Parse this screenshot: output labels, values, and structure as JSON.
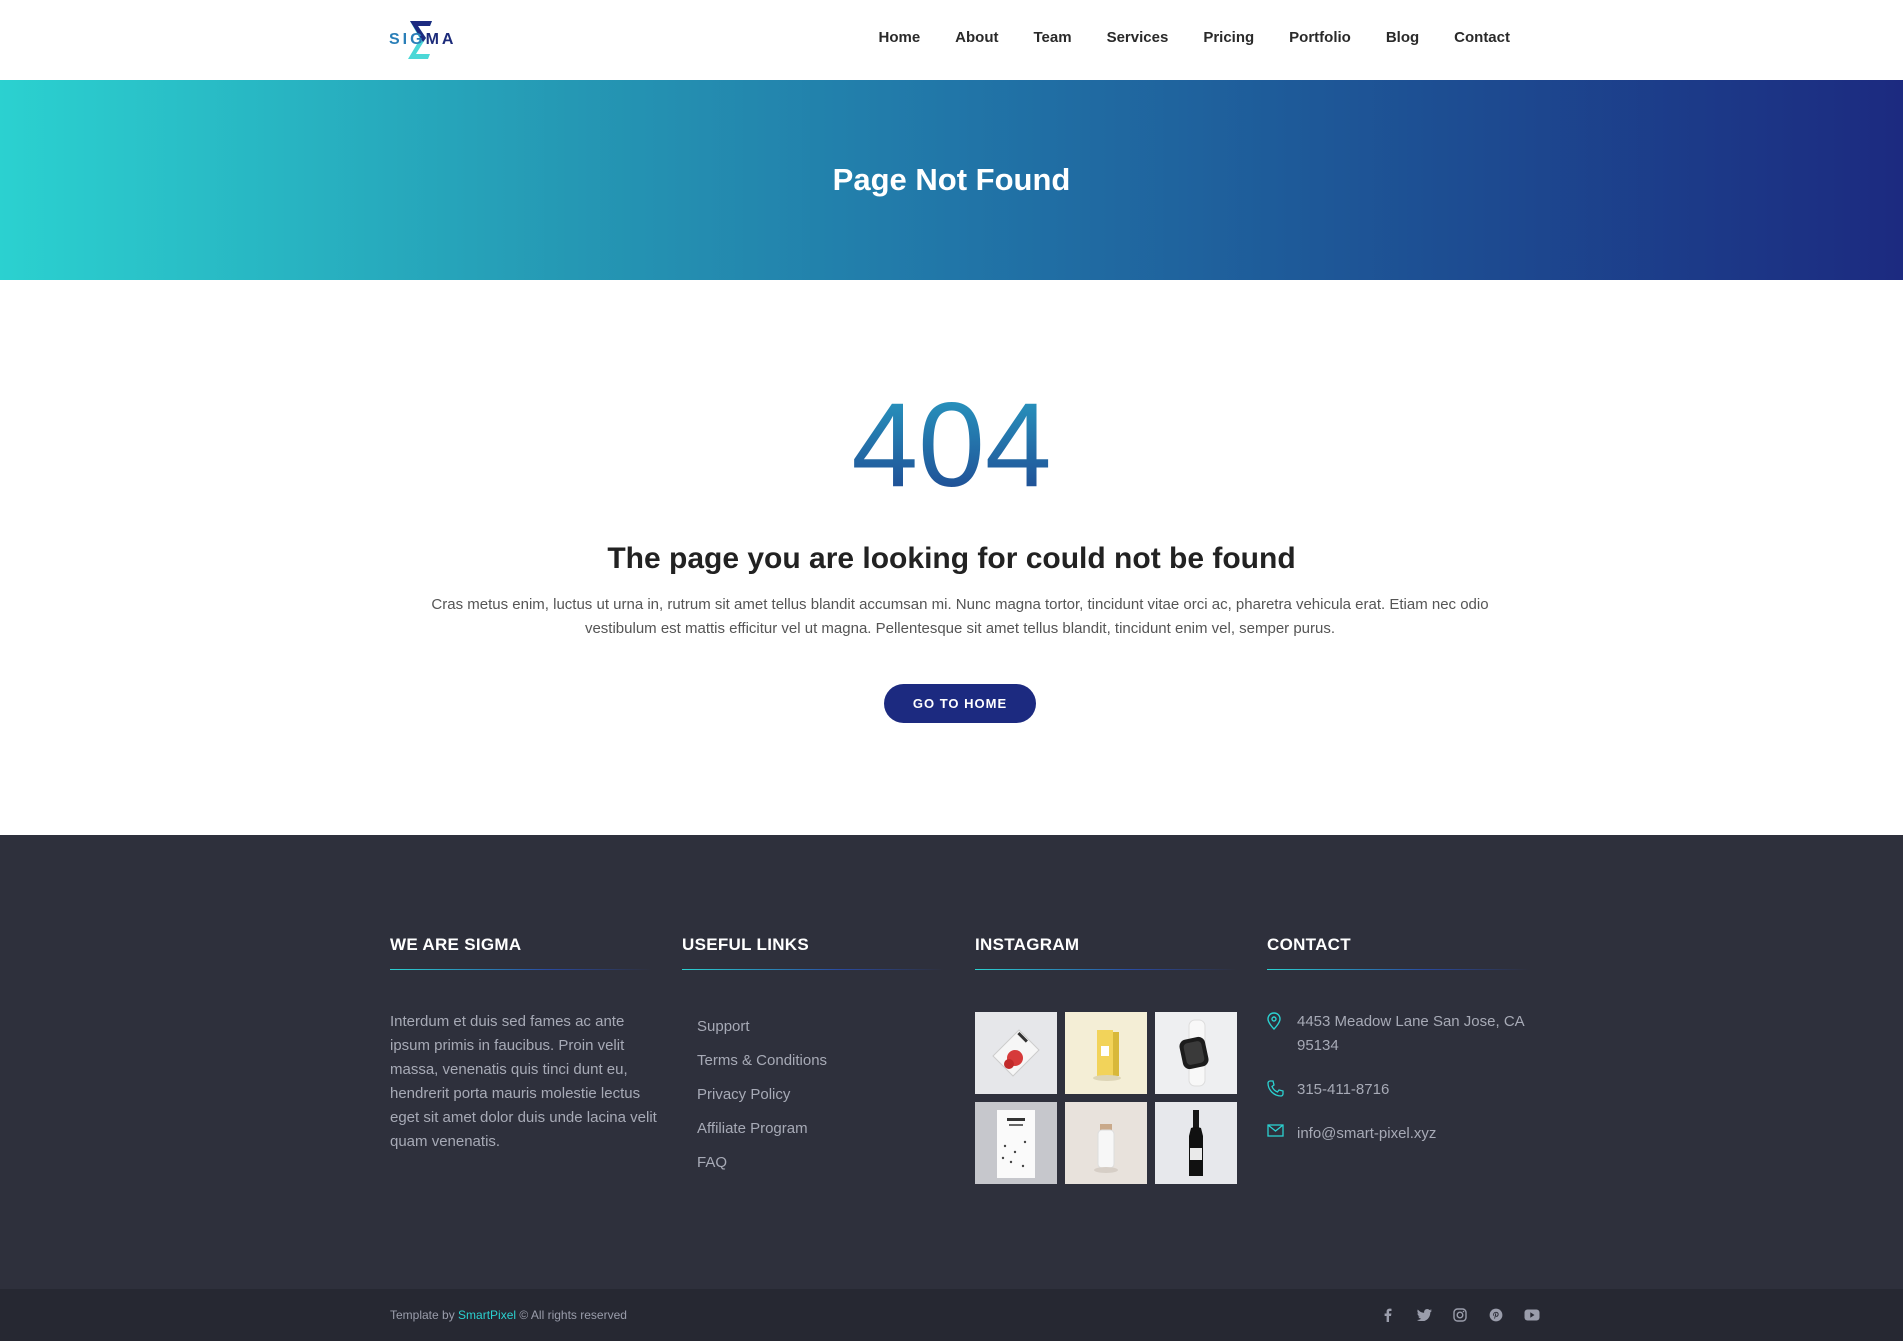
{
  "header": {
    "logo_text_a": "SIG",
    "logo_text_b": "MA",
    "nav": [
      "Home",
      "About",
      "Team",
      "Services",
      "Pricing",
      "Portfolio",
      "Blog",
      "Contact"
    ]
  },
  "hero": {
    "title": "Page Not Found"
  },
  "main": {
    "code": "404",
    "title": "The page you are looking for could not be found",
    "description": "Cras metus enim, luctus ut urna in, rutrum sit amet tellus blandit accumsan mi. Nunc magna tortor, tincidunt vitae orci ac, pharetra vehicula erat. Etiam nec odio vestibulum est mattis efficitur vel ut magna. Pellentesque sit amet tellus blandit, tincidunt enim vel, semper purus.",
    "button": "GO TO HOME"
  },
  "footer": {
    "about": {
      "heading": "WE ARE SIGMA",
      "text": "Interdum et duis sed fames ac ante ipsum primis in faucibus. Proin velit massa, venenatis quis tinci dunt eu, hendrerit porta mauris molestie lectus eget sit amet dolor duis unde lacina velit quam venenatis."
    },
    "links": {
      "heading": "USEFUL LINKS",
      "items": [
        "Support",
        "Terms & Conditions",
        "Privacy Policy",
        "Affiliate Program",
        "FAQ"
      ]
    },
    "instagram": {
      "heading": "INSTAGRAM",
      "tiles": [
        "book-cover",
        "yellow-box",
        "smartwatch",
        "poster",
        "bottle",
        "wine-bottle"
      ]
    },
    "contact": {
      "heading": "CONTACT",
      "address": "4453 Meadow Lane San Jose, CA 95134",
      "phone": "315-411-8716",
      "email": "info@smart-pixel.xyz"
    }
  },
  "bottom": {
    "prefix": "Template by ",
    "brand": "SmartPixel",
    "suffix": " © All rights reserved",
    "socials": [
      "facebook-icon",
      "twitter-icon",
      "instagram-icon",
      "pinterest-icon",
      "youtube-icon"
    ]
  },
  "colors": {
    "accent": "#2bd1d0",
    "primary": "#1c2a80",
    "footer_bg": "#2e303c",
    "bottom_bg": "#262832"
  }
}
